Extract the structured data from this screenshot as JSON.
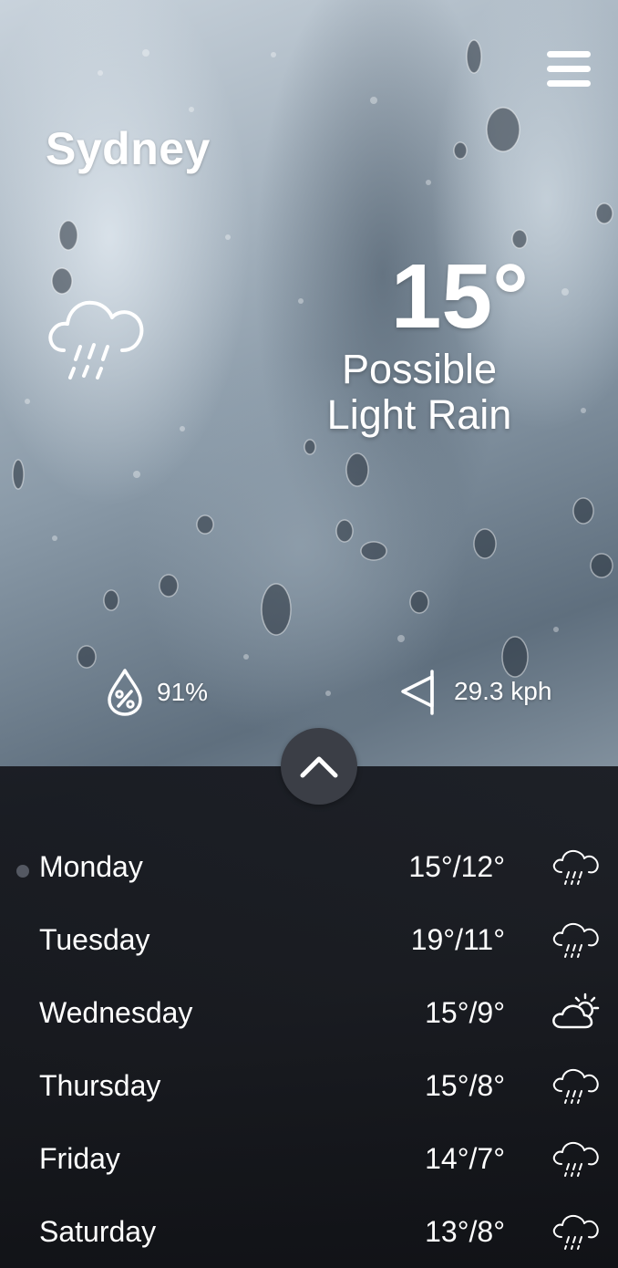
{
  "location": {
    "city": "Sydney"
  },
  "current": {
    "temperature": "15°",
    "condition_line1": "Possible",
    "condition_line2": "Light Rain",
    "icon": "cloud-rain-icon"
  },
  "stats": {
    "humidity": {
      "value": "91%",
      "icon": "humidity-drop-icon"
    },
    "wind": {
      "value": "29.3 kph",
      "icon": "wind-direction-icon"
    }
  },
  "menu": {
    "icon": "hamburger-menu-icon"
  },
  "expand": {
    "icon": "chevron-up-icon"
  },
  "forecast": [
    {
      "day": "Monday",
      "range": "15°/12°",
      "icon": "rain-icon",
      "selected": true
    },
    {
      "day": "Tuesday",
      "range": "19°/11°",
      "icon": "rain-icon",
      "selected": false
    },
    {
      "day": "Wednesday",
      "range": "15°/9°",
      "icon": "partly-cloudy-icon",
      "selected": false
    },
    {
      "day": "Thursday",
      "range": "15°/8°",
      "icon": "rain-icon",
      "selected": false
    },
    {
      "day": "Friday",
      "range": "14°/7°",
      "icon": "rain-icon",
      "selected": false
    },
    {
      "day": "Saturday",
      "range": "13°/8°",
      "icon": "rain-icon",
      "selected": false
    }
  ],
  "colors": {
    "panel": "#16181e",
    "expand_button": "#3b3e46",
    "selected_dot": "#545862",
    "text": "#ffffff"
  }
}
